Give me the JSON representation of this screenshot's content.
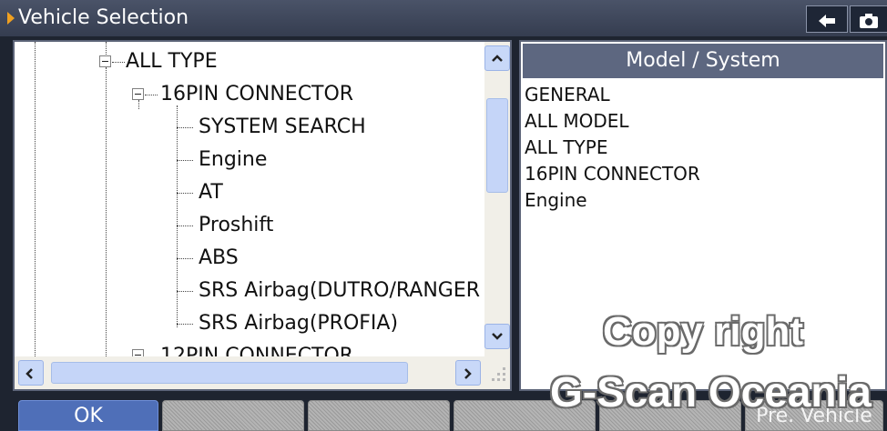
{
  "titlebar": {
    "title": "Vehicle Selection",
    "back_icon": "back-arrow-icon",
    "camera_icon": "camera-icon"
  },
  "tree": {
    "items": [
      {
        "label": "ALL TYPE",
        "type": "expanded-node"
      },
      {
        "label": "16PIN CONNECTOR",
        "type": "expanded-node"
      },
      {
        "label": "SYSTEM SEARCH",
        "type": "leaf"
      },
      {
        "label": "Engine",
        "type": "leaf"
      },
      {
        "label": "AT",
        "type": "leaf"
      },
      {
        "label": "Proshift",
        "type": "leaf"
      },
      {
        "label": "ABS",
        "type": "leaf"
      },
      {
        "label": "SRS Airbag(DUTRO/RANGER",
        "type": "leaf"
      },
      {
        "label": "SRS Airbag(PROFIA)",
        "type": "leaf"
      },
      {
        "label": "12PIN CONNECTOR",
        "type": "collapsed-node"
      }
    ]
  },
  "model_panel": {
    "header": "Model / System",
    "rows": [
      "GENERAL",
      "ALL MODEL",
      "ALL TYPE",
      "16PIN CONNECTOR",
      "Engine"
    ]
  },
  "bottom_bar": {
    "ok_label": "OK",
    "pre_vehicle_label": "Pre. Vehicle"
  },
  "watermark": {
    "line1": "Copy right",
    "line2": "G-Scan Oceania"
  },
  "colors": {
    "titlebar": "#3d4559",
    "accent_arrow": "#f0a020",
    "ok_button": "#4f6fb8",
    "model_header": "#5d6780"
  }
}
